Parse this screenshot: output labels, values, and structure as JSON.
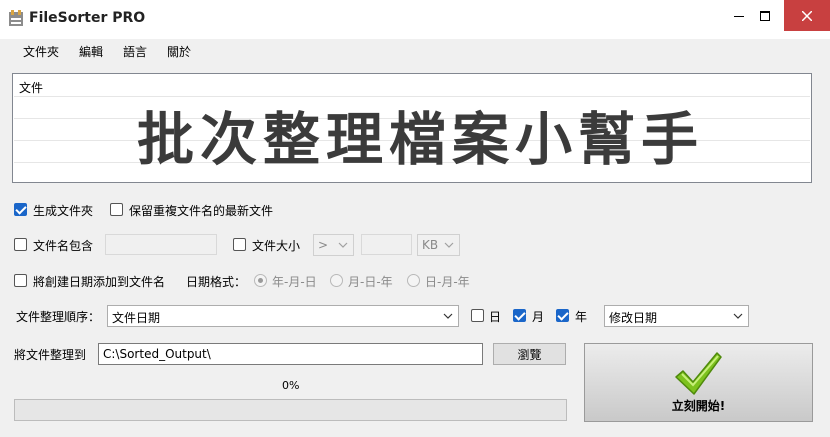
{
  "window": {
    "title": "FileSorter PRO"
  },
  "menu": {
    "items": [
      "文件夾",
      "編輯",
      "語言",
      "關於"
    ]
  },
  "doc_list": {
    "header": "文件",
    "banner": "批次整理檔案小幫手"
  },
  "options": {
    "create_folder": {
      "label": "生成文件夾",
      "checked": true
    },
    "keep_newest": {
      "label": "保留重複文件名的最新文件",
      "checked": false
    },
    "name_contains": {
      "label": "文件名包含",
      "checked": false,
      "value": ""
    },
    "file_size": {
      "label": "文件大小",
      "checked": false,
      "operator": ">",
      "value": "",
      "unit": "KB"
    },
    "add_date": {
      "label": "將創建日期添加到文件名",
      "checked": false
    },
    "date_format": {
      "label": "日期格式：",
      "choices": [
        "年-月-日",
        "月-日-年",
        "日-月-年"
      ],
      "selected": "年-月-日"
    },
    "sort_order": {
      "label": "文件整理順序：",
      "value": "文件日期"
    },
    "day": {
      "label": "日",
      "checked": false
    },
    "month": {
      "label": "月",
      "checked": true
    },
    "year": {
      "label": "年",
      "checked": true
    },
    "date_source": {
      "value": "修改日期"
    },
    "output": {
      "label": "將文件整理到",
      "value": "C:\\Sorted_Output\\",
      "browse_label": "瀏覽"
    }
  },
  "progress": {
    "text": "0%",
    "value": 0
  },
  "start": {
    "label": "立刻開始!"
  },
  "colors": {
    "accent": "#1a66c9",
    "close": "#c84040",
    "check_green": "#7dc21e"
  }
}
